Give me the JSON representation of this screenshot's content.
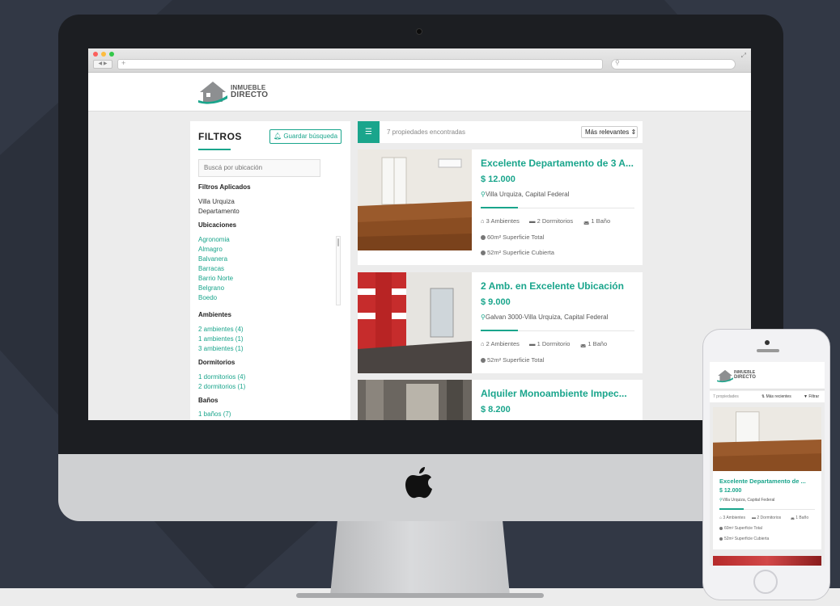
{
  "colors": {
    "accent": "#1aa58c",
    "bezel": "#1c1e22",
    "chin": "#cfd0d2",
    "background": "#323845"
  },
  "icons": [
    "apple-icon",
    "list-icon",
    "bell-icon",
    "map-marker-icon",
    "home-icon",
    "bed-icon",
    "bath-icon",
    "circle-icon",
    "sort-icon",
    "filter-icon"
  ],
  "brand": {
    "line1": "INMUEBLE",
    "line2": "DIRECTO"
  },
  "browser": {
    "new_tab": "+",
    "nav": "◀ ▶",
    "search_icon": "⚲"
  },
  "sidebar": {
    "title": "FILTROS",
    "save_label": "Guardar búsqueda",
    "location_placeholder": "Buscá por ubicación",
    "applied_heading": "Filtros Aplicados",
    "applied": [
      "Villa Urquiza",
      "Departamento"
    ],
    "ubicaciones_heading": "Ubicaciones",
    "ubicaciones": [
      "Agronomia",
      "Almagro",
      "Balvanera",
      "Barracas",
      "Barrio Norte",
      "Belgrano",
      "Boedo"
    ],
    "ambientes_heading": "Ambientes",
    "ambientes": [
      "2 ambientes (4)",
      "1 ambientes (1)",
      "3 ambientes (1)"
    ],
    "dormitorios_heading": "Dormitorios",
    "dormitorios": [
      "1 dormitorios (4)",
      "2 dormitorios (1)"
    ],
    "banos_heading": "Baños",
    "banos": [
      "1 baños (7)"
    ]
  },
  "results": {
    "count_text": "7 propiedades encontradas",
    "sort_label": "Más relevantes ⇕"
  },
  "listings": [
    {
      "title": "Excelente Departamento de 3 A...",
      "price": "$ 12.000",
      "location": "Villa Urquiza, Capital Federal",
      "ambientes": "3 Ambientes",
      "dormitorios": "2 Dormitorios",
      "banos": "1 Baño",
      "sup_total": "60m² Superficie Total",
      "sup_cubierta": "52m² Superficie Cubierta"
    },
    {
      "title": "2 Amb. en Excelente Ubicación",
      "price": "$ 9.000",
      "location": "Galvan 3000-Villa Urquiza, Capital Federal",
      "ambientes": "2 Ambientes",
      "dormitorios": "1 Dormitorio",
      "banos": "1 Baño",
      "sup_total": "52m² Superficie Total"
    },
    {
      "title": "Alquiler Monoambiente Impec...",
      "price": "$ 8.200"
    }
  ],
  "mobile": {
    "count_text": "7 propiedades",
    "sort_label": "Más recientes",
    "filter_label": "Filtrar",
    "card": {
      "title": "Excelente Departamento de ...",
      "price": "$ 12.000",
      "location": "Villa Urquiza, Capital Federal",
      "ambientes": "3 Ambientes",
      "dormitorios": "2 Dormitorios",
      "banos": "1 Baño",
      "sup_total": "60m² Superficie Total",
      "sup_cubierta": "52m² Superficie Cubierta"
    }
  }
}
